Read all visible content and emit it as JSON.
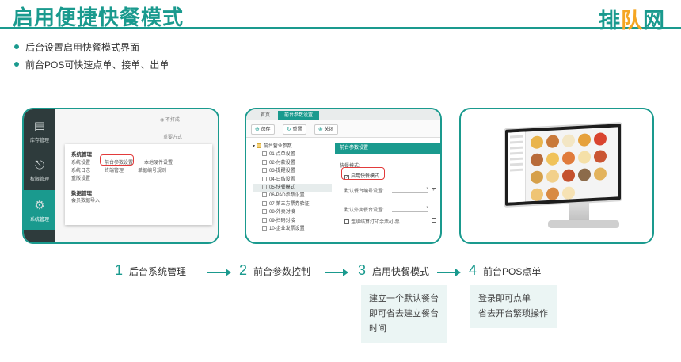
{
  "title": "启用便捷快餐模式",
  "logo": {
    "left": "排",
    "mid": "队",
    "right": "网"
  },
  "bullets": [
    "后台设置启用快餐模式界面",
    "前台POS可快速点单、接单、出单"
  ],
  "panel1": {
    "nav": [
      {
        "label": "库存管理",
        "icon": "inventory-icon"
      },
      {
        "label": "权限管理",
        "icon": "lock-icon"
      },
      {
        "label": "系统管理",
        "icon": "gear-icon"
      }
    ],
    "bg_texts": [
      "不打成",
      "重要方式",
      "打"
    ],
    "card": {
      "section1_title": "系统管理",
      "links_col1": [
        "系统设置",
        "系统日志",
        "重版设置"
      ],
      "links_col2": [
        "前台参数设置",
        "终端管理"
      ],
      "links_col3": [
        "本地硬件设置",
        "单据编号规则"
      ],
      "section2_title": "数据管理",
      "section2_link": "会员数据导入"
    }
  },
  "panel2": {
    "tabs": [
      "首页",
      "前台参数设置"
    ],
    "toolbar": [
      "保存",
      "重置",
      "关闭"
    ],
    "tree_root": "前台营业参数",
    "tree": [
      "01-点单设置",
      "02-付款设置",
      "03-提醒设置",
      "04-日结设置",
      "05-快餐模式",
      "06-PAD参数设置",
      "07-第三方票券验证",
      "08-外卖对接",
      "09-扫码对接",
      "10-企业发票设置"
    ],
    "header": "前台参数设置",
    "section": "快餐模式:",
    "enable_label": "启用快餐模式",
    "field1": "默认餐台编号设置:",
    "field2": "默认外卖餐台设置:",
    "field3": "连续结算打印余票/小票"
  },
  "steps": [
    {
      "num": "1",
      "label": "后台系统管理"
    },
    {
      "num": "2",
      "label": "前台参数控制"
    },
    {
      "num": "3",
      "label": "启用快餐模式"
    },
    {
      "num": "4",
      "label": "前台POS点单"
    }
  ],
  "notes": [
    {
      "lines": [
        "建立一个默认餐台",
        "即可省去建立餐台时间"
      ]
    },
    {
      "lines": [
        "登录即可点单",
        "省去开台繁琐操作"
      ]
    }
  ],
  "colors": {
    "accent": "#1a9a8e",
    "highlight": "#e23b3b",
    "logo_mid": "#f5a623"
  }
}
